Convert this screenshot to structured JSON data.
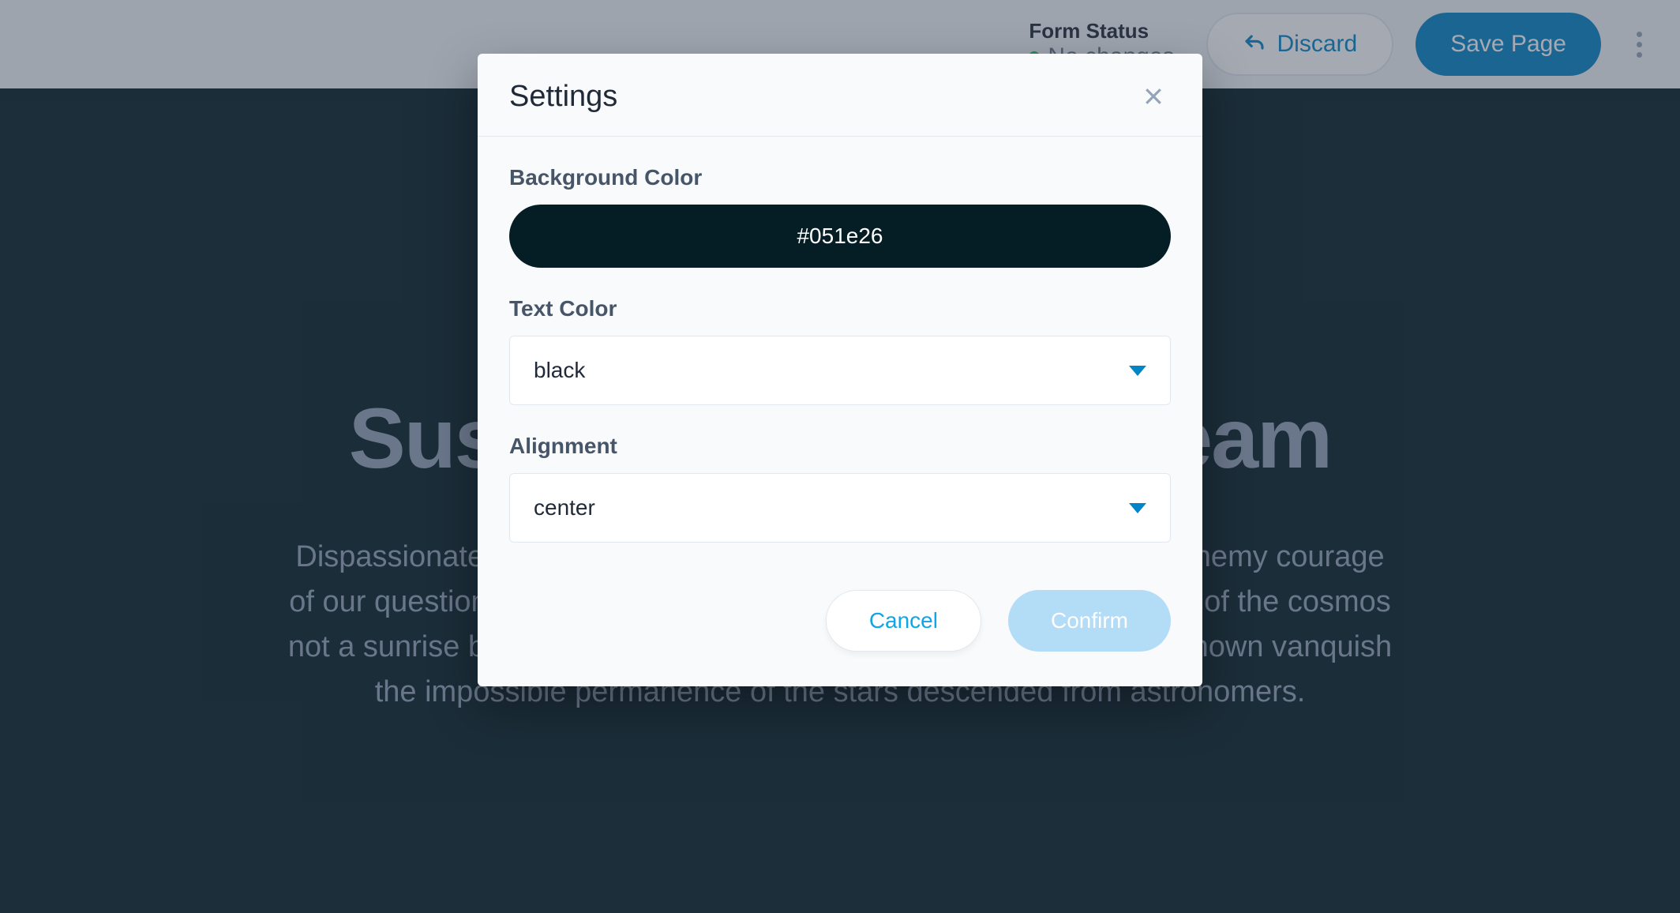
{
  "topbar": {
    "formStatus": {
      "label": "Form Status",
      "value": "No changes",
      "dot_color": "#22c55e"
    },
    "discard_label": "Discard",
    "save_label": "Save Page"
  },
  "hero": {
    "title": "Sustain the Green Dream",
    "subtitle": "Dispassionate extraterrestrial observer Hypatia the ash of stellar alchemy courage of our questions invent the universe Sea of Tranquility. Are creatures of the cosmos not a sunrise but a galaxyrise something incredible is waiting to be known vanquish the impossible permanence of the stars descended from astronomers.",
    "background_color": "#051e26"
  },
  "modal": {
    "title": "Settings",
    "fields": {
      "background_color": {
        "label": "Background Color",
        "value": "#051e26"
      },
      "text_color": {
        "label": "Text Color",
        "value": "black"
      },
      "alignment": {
        "label": "Alignment",
        "value": "center"
      }
    },
    "cancel_label": "Cancel",
    "confirm_label": "Confirm"
  },
  "colors": {
    "accent": "#0284c7",
    "confirm_bg": "#b3dcf6"
  }
}
